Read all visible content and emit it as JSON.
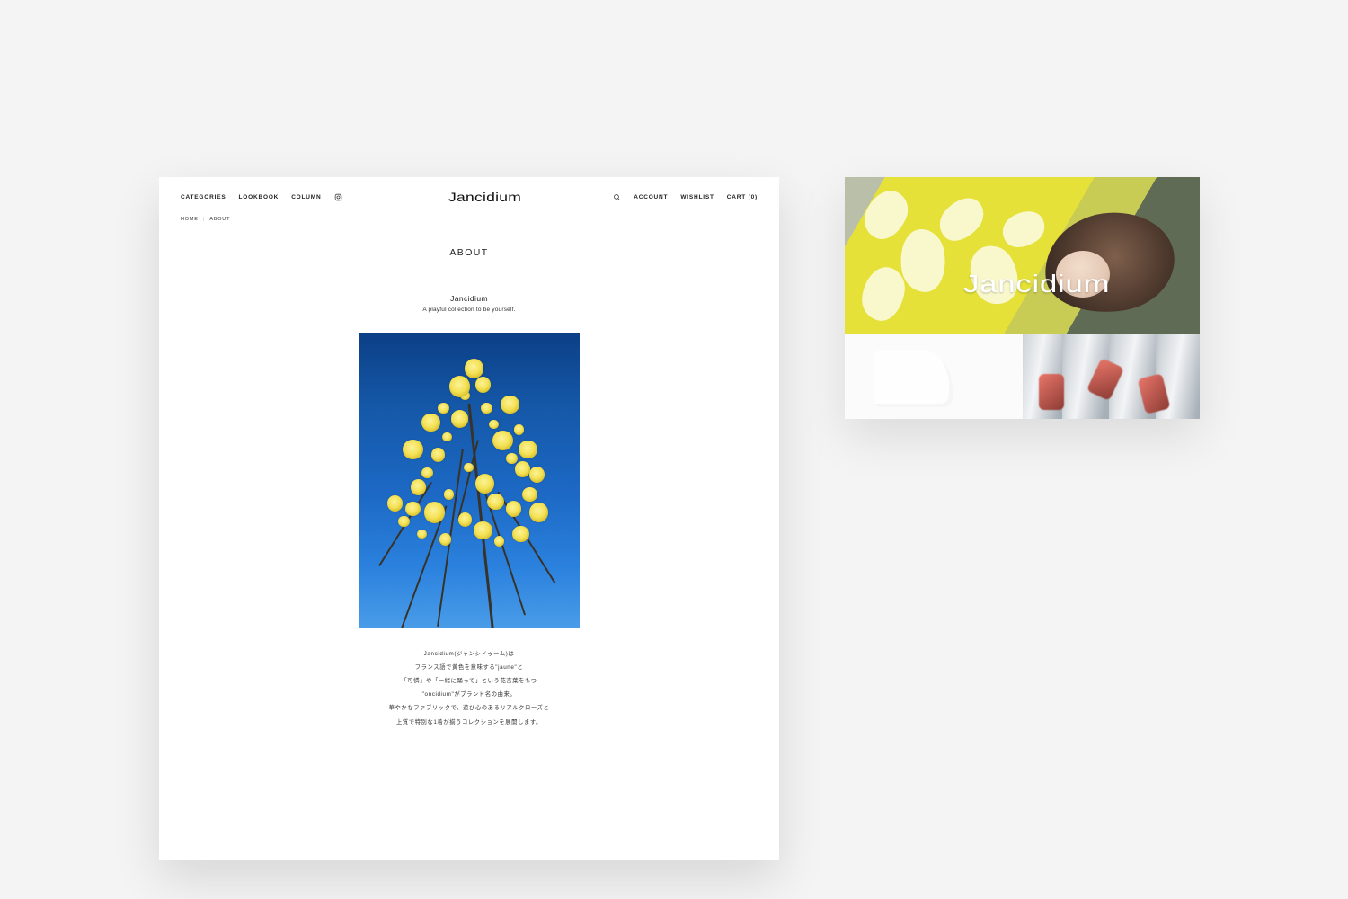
{
  "nav": {
    "categories": "CATEGORIES",
    "lookbook": "LOOKBOOK",
    "column": "COLUMN",
    "account": "ACCOUNT",
    "wishlist": "WISHLIST",
    "cart": "CART (0)"
  },
  "logo": "Jancidium",
  "breadcrumb": {
    "home": "HOME",
    "about": "ABOUT"
  },
  "page_title": "ABOUT",
  "brand_subtitle": "Jancidium",
  "tagline": "A playful collection to be yourself.",
  "description": {
    "l1": "Jancidium(ジャンシドゥーム)は",
    "l2": "フランス語で黄色を意味する\"jaune\"と",
    "l3": "「可憐」や「一緒に踊って」という花言葉をもつ",
    "l4": "\"oncidium\"がブランド名の由来。",
    "l5": "華やかなファブリックで、遊び心のあるリアルクローズと",
    "l6": "上質で特別な1着が揃うコレクションを展開します。"
  },
  "mobile": {
    "hero_logo": "Jancidium"
  }
}
